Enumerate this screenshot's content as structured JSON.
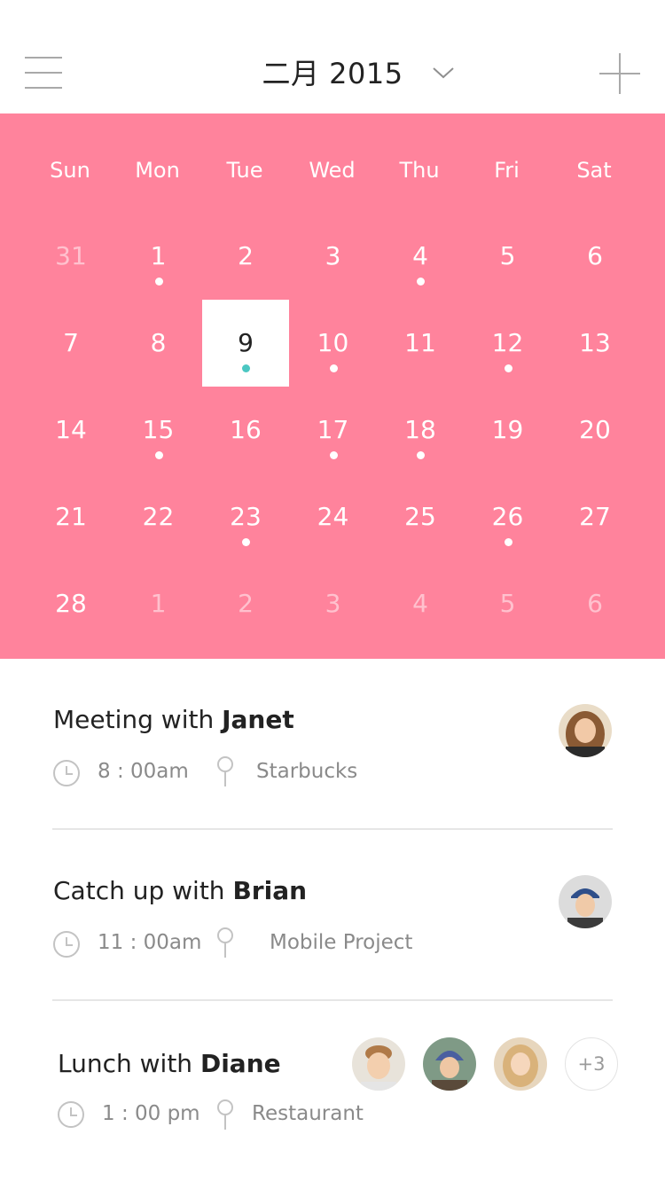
{
  "header": {
    "title": "二月 2015",
    "menu_icon": "hamburger-menu-icon",
    "dropdown_icon": "chevron-down-icon",
    "add_icon": "plus-icon"
  },
  "calendar": {
    "weekdays": [
      "Sun",
      "Mon",
      "Tue",
      "Wed",
      "Thu",
      "Fri",
      "Sat"
    ],
    "weeks": [
      [
        {
          "d": "31",
          "muted": true,
          "dot": false
        },
        {
          "d": "1",
          "muted": false,
          "dot": true
        },
        {
          "d": "2",
          "muted": false,
          "dot": false
        },
        {
          "d": "3",
          "muted": false,
          "dot": false
        },
        {
          "d": "4",
          "muted": false,
          "dot": true
        },
        {
          "d": "5",
          "muted": false,
          "dot": false
        },
        {
          "d": "6",
          "muted": false,
          "dot": false
        }
      ],
      [
        {
          "d": "7",
          "muted": false,
          "dot": false
        },
        {
          "d": "8",
          "muted": false,
          "dot": false
        },
        {
          "d": "9",
          "muted": false,
          "dot": true,
          "selected": true
        },
        {
          "d": "10",
          "muted": false,
          "dot": true
        },
        {
          "d": "11",
          "muted": false,
          "dot": false
        },
        {
          "d": "12",
          "muted": false,
          "dot": true
        },
        {
          "d": "13",
          "muted": false,
          "dot": false
        }
      ],
      [
        {
          "d": "14",
          "muted": false,
          "dot": false
        },
        {
          "d": "15",
          "muted": false,
          "dot": true
        },
        {
          "d": "16",
          "muted": false,
          "dot": false
        },
        {
          "d": "17",
          "muted": false,
          "dot": true
        },
        {
          "d": "18",
          "muted": false,
          "dot": true
        },
        {
          "d": "19",
          "muted": false,
          "dot": false
        },
        {
          "d": "20",
          "muted": false,
          "dot": false
        }
      ],
      [
        {
          "d": "21",
          "muted": false,
          "dot": false
        },
        {
          "d": "22",
          "muted": false,
          "dot": false
        },
        {
          "d": "23",
          "muted": false,
          "dot": true
        },
        {
          "d": "24",
          "muted": false,
          "dot": false
        },
        {
          "d": "25",
          "muted": false,
          "dot": false
        },
        {
          "d": "26",
          "muted": false,
          "dot": true
        },
        {
          "d": "27",
          "muted": false,
          "dot": false
        }
      ],
      [
        {
          "d": "28",
          "muted": false,
          "dot": false
        },
        {
          "d": "1",
          "muted": true,
          "dot": false
        },
        {
          "d": "2",
          "muted": true,
          "dot": false
        },
        {
          "d": "3",
          "muted": true,
          "dot": false
        },
        {
          "d": "4",
          "muted": true,
          "dot": false
        },
        {
          "d": "5",
          "muted": true,
          "dot": false
        },
        {
          "d": "6",
          "muted": true,
          "dot": false
        }
      ]
    ],
    "selected_day": "9"
  },
  "events": [
    {
      "title_prefix": "Meeting with ",
      "person": "Janet",
      "time": "8 : 00am",
      "location": "Starbucks",
      "avatars": [
        "avatar-janet"
      ],
      "more": ""
    },
    {
      "title_prefix": "Catch up with ",
      "person": "Brian",
      "time": "11 : 00am",
      "location": "Mobile Project",
      "avatars": [
        "avatar-brian"
      ],
      "more": ""
    },
    {
      "title_prefix": "Lunch with ",
      "person": "Diane",
      "time": "1 : 00 pm",
      "location": "Restaurant",
      "avatars": [
        "avatar-man",
        "avatar-woman-beanie",
        "avatar-woman-blonde"
      ],
      "more": "+3"
    }
  ],
  "colors": {
    "calendar_bg": "#ff839c",
    "selected_dot": "#4bc7c2",
    "muted_text": "#8a8a8a",
    "divider": "#e6e6e6"
  }
}
